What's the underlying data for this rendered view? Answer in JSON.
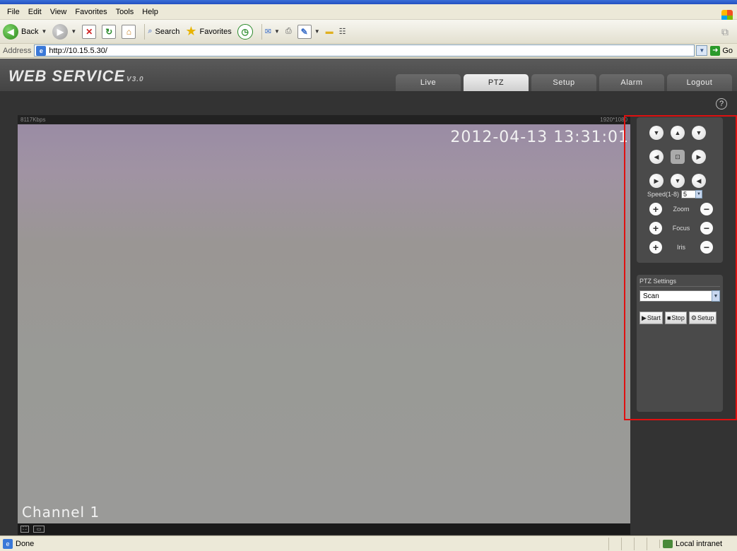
{
  "browser": {
    "menu": [
      "File",
      "Edit",
      "View",
      "Favorites",
      "Tools",
      "Help"
    ],
    "toolbar": {
      "back_label": "Back",
      "search_label": "Search",
      "favorites_label": "Favorites"
    },
    "address": {
      "label": "Address",
      "url": "http://10.15.5.30/",
      "go_label": "Go"
    },
    "status": {
      "text": "Done",
      "zone": "Local intranet"
    }
  },
  "app": {
    "brand": "WEB  SERVICE",
    "version": "V3.0",
    "tabs": [
      {
        "label": "Live",
        "active": false
      },
      {
        "label": "PTZ",
        "active": true
      },
      {
        "label": "Setup",
        "active": false
      },
      {
        "label": "Alarm",
        "active": false
      },
      {
        "label": "Logout",
        "active": false
      }
    ],
    "help_symbol": "?"
  },
  "video": {
    "bitrate": "8117Kbps",
    "resolution": "1920*1080",
    "timestamp": "2012-04-13 13:31:01",
    "channel": "Channel 1"
  },
  "ptz": {
    "speed_label": "Speed(1-8)",
    "speed_value": "5",
    "controls": [
      {
        "label": "Zoom"
      },
      {
        "label": "Focus"
      },
      {
        "label": "Iris"
      }
    ]
  },
  "ptz_settings": {
    "title": "PTZ Settings",
    "mode": "Scan",
    "buttons": {
      "start": "Start",
      "stop": "Stop",
      "setup": "Setup"
    }
  },
  "colors": {
    "highlight": "#e01010",
    "active_tab": "#e6e6e6"
  }
}
